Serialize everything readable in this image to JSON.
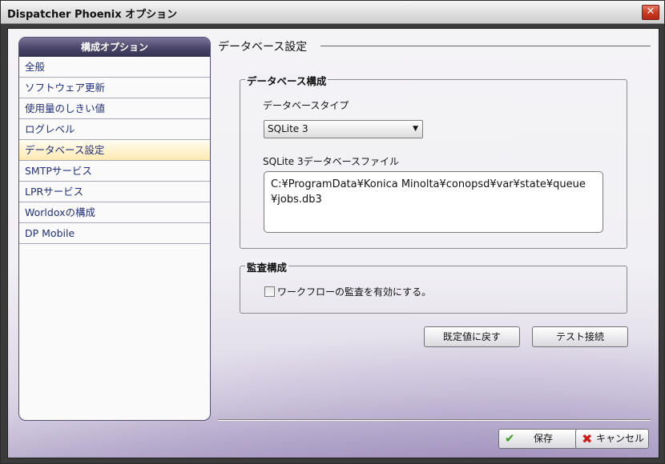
{
  "window": {
    "title": "Dispatcher Phoenix オプション",
    "close_glyph": "✕"
  },
  "sidebar": {
    "header": "構成オプション",
    "items": [
      {
        "label": "全般"
      },
      {
        "label": "ソフトウェア更新"
      },
      {
        "label": "使用量のしきい値"
      },
      {
        "label": "ログレベル"
      },
      {
        "label": "データベース設定",
        "selected": true
      },
      {
        "label": "SMTPサービス"
      },
      {
        "label": "LPRサービス"
      },
      {
        "label": "Worldoxの構成"
      },
      {
        "label": "DP Mobile"
      }
    ]
  },
  "main": {
    "section_title": "データベース設定",
    "db_group": {
      "legend": "データベース構成",
      "type_label": "データベースタイプ",
      "type_value": "SQLite 3",
      "file_label": "SQLite 3データベースファイル",
      "file_value": "C:¥ProgramData¥Konica Minolta¥conopsd¥var¥state¥queue\n¥jobs.db3"
    },
    "audit_group": {
      "legend": "監査構成",
      "checkbox_label": "ワークフローの監査を有効にする。",
      "checked": false
    },
    "restore_defaults_label": "既定値に戻す",
    "test_connection_label": "テスト接続"
  },
  "footer": {
    "save_label": "保存",
    "cancel_label": "キャンセル",
    "save_icon": "checkmark-icon",
    "cancel_icon": "x-icon"
  },
  "colors": {
    "sidebar_header": "#4a4568",
    "selected_item": "#fde9b0",
    "sidebar_text": "#22307a",
    "accent_purple": "#806ca8"
  }
}
